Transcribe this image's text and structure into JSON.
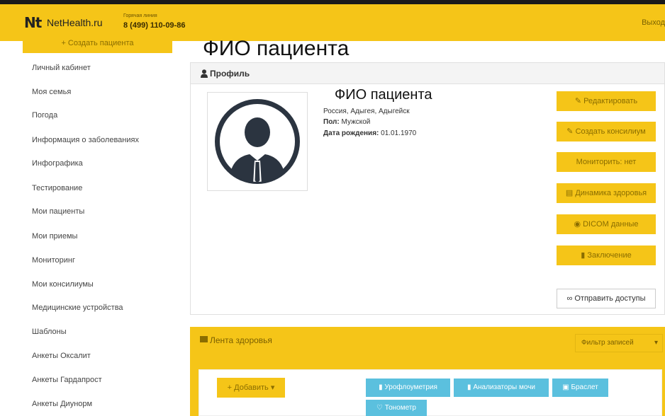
{
  "header": {
    "logo_mark": "Nt",
    "logo_text": "NetHealth.ru",
    "hotline_label": "Горячая линия",
    "hotline_phone": "8 (499) 110-09-86",
    "logout": "Выход"
  },
  "sidebar": {
    "create_patient": "+ Создать пациента",
    "items": [
      "Личный кабинет",
      "Моя семья",
      "Погода",
      "Информация о заболеваниях",
      "Инфографика",
      "Тестирование",
      "Мои пациенты",
      "Мои приемы",
      "Мониторинг",
      "Мои консилиумы",
      "Медицинские устройства",
      "Шаблоны",
      "Анкеты Оксалит",
      "Анкеты Гардапрост",
      "Анкеты Диунорм"
    ]
  },
  "overlay_title": "ФИО пациента",
  "profile": {
    "panel_title": "Профиль",
    "fio": "ФИО пациента",
    "location": "Россия, Адыгея, Адыгейск",
    "gender_label": "Пол:",
    "gender_value": "Мужской",
    "dob_label": "Дата рождения:",
    "dob_value": "01.01.1970",
    "buttons": {
      "edit": "Редактировать",
      "consilium": "Создать консилиум",
      "monitor": "Мониторить: нет",
      "dynamics": "Динамика здоровья",
      "dicom": "DICOM данные",
      "conclusion": "Заключение",
      "send_access": "Отправить доступы"
    }
  },
  "feed": {
    "title": "Лента здоровья",
    "filter": "Фильтр записей",
    "add": "+ Добавить",
    "tags": [
      "Урофлоуметрия",
      "Анализаторы мочи",
      "Браслет",
      "Тонометр"
    ]
  },
  "colors": {
    "accent": "#f5c518",
    "info": "#5bc0de",
    "avatar": "#2b3440"
  }
}
